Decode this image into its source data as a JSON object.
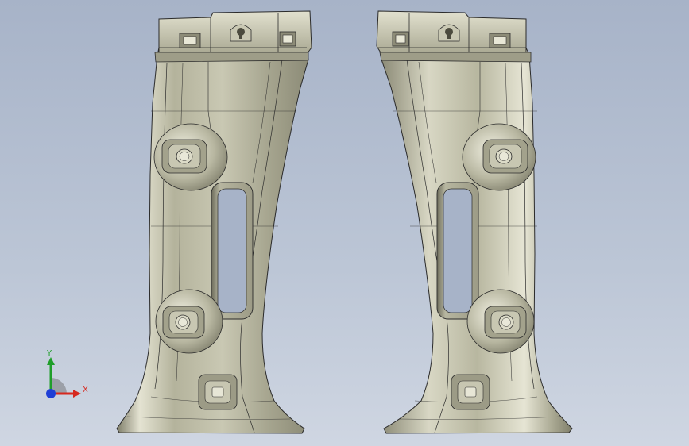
{
  "triad": {
    "x_label": "X",
    "y_label": "Y",
    "colors": {
      "x": "#d6281e",
      "y": "#1f9e2a",
      "z": "#1f3fd6"
    }
  },
  "model": {
    "part_color": "#b9b8a0",
    "edge_color": "#2b2b2b",
    "background_top": "#a7b3c8",
    "background_bottom": "#cfd6e2"
  }
}
